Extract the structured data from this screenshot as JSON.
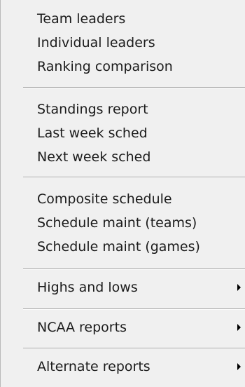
{
  "menu": {
    "groups": [
      {
        "items": [
          {
            "label": "Team leaders"
          },
          {
            "label": "Individual leaders"
          },
          {
            "label": "Ranking comparison"
          }
        ]
      },
      {
        "items": [
          {
            "label": "Standings report"
          },
          {
            "label": "Last week sched"
          },
          {
            "label": "Next week sched"
          }
        ]
      },
      {
        "items": [
          {
            "label": "Composite schedule"
          },
          {
            "label": "Schedule maint (teams)"
          },
          {
            "label": "Schedule maint (games)"
          }
        ]
      },
      {
        "items": [
          {
            "label": "Highs and lows",
            "submenu_icon": "chevron-right-icon"
          }
        ]
      },
      {
        "items": [
          {
            "label": "NCAA reports",
            "submenu_icon": "chevron-right-icon"
          }
        ]
      },
      {
        "items": [
          {
            "label": "Alternate reports",
            "submenu_icon": "chevron-right-icon"
          }
        ]
      }
    ]
  }
}
